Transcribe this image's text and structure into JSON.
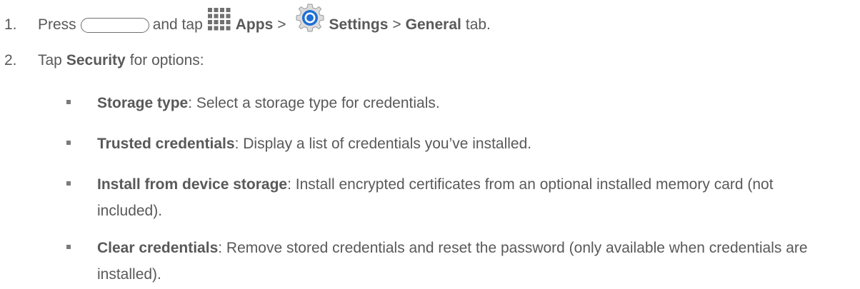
{
  "step1": {
    "number": "1.",
    "press": "Press",
    "and_tap": "and tap",
    "apps": "Apps",
    "sep1": ">",
    "settings": "Settings",
    "sep2": ">",
    "general": "General",
    "tab": "tab."
  },
  "step2": {
    "number": "2.",
    "tap": "Tap",
    "security": "Security",
    "for_options": "for options:"
  },
  "options": [
    {
      "term": "Storage type",
      "desc": ": Select a storage type for credentials."
    },
    {
      "term": "Trusted credentials",
      "desc": ": Display a list of credentials you’ve installed."
    },
    {
      "term": "Install from device storage",
      "desc": ": Install encrypted certificates from an optional installed memory card (not included)."
    },
    {
      "term": "Clear credentials",
      "desc": ": Remove stored credentials and reset the password (only available when credentials are installed)."
    }
  ],
  "icons": {
    "home": "home-button-icon",
    "apps": "apps-grid-icon",
    "settings": "settings-gear-icon"
  },
  "colors": {
    "text": "#595959",
    "settings_blue": "#1e6fd6"
  }
}
